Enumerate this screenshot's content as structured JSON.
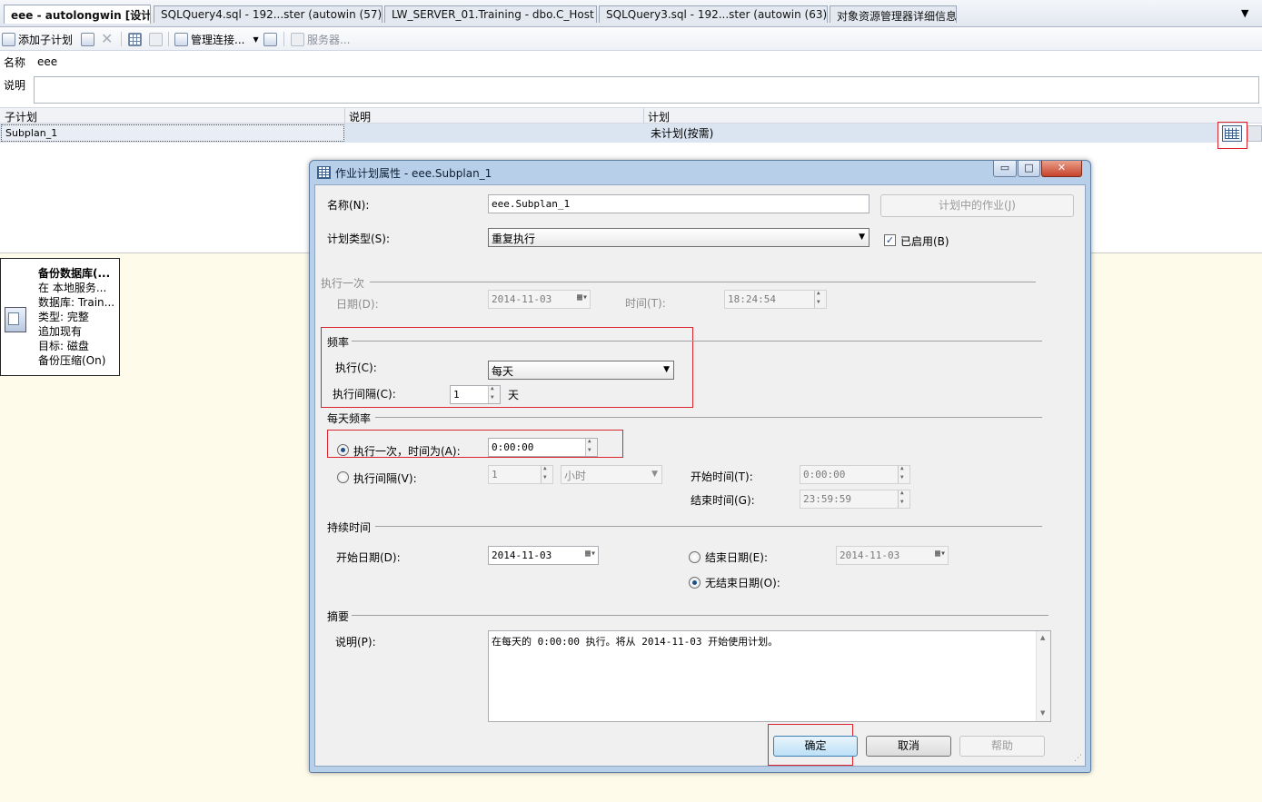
{
  "tabs": [
    {
      "label": "eee - autolongwin [设计]",
      "active": true
    },
    {
      "label": "SQLQuery4.sql - 192...ster (autowin (57))",
      "active": false
    },
    {
      "label": "LW_SERVER_01.Training - dbo.C_Host",
      "active": false
    },
    {
      "label": "SQLQuery3.sql - 192...ster (autowin (63))",
      "active": false
    },
    {
      "label": "对象资源管理器详细信息",
      "active": false
    }
  ],
  "tab_overflow_icon": "▼",
  "toolbar": {
    "add_subplan": "添加子计划",
    "manage_connections": "管理连接...",
    "servers": "服务器..."
  },
  "plan": {
    "name_label": "名称",
    "name_value": "eee",
    "desc_label": "说明",
    "desc_value": ""
  },
  "subplan_grid": {
    "headers": [
      "子计划",
      "说明",
      "计划"
    ],
    "rows": [
      {
        "name": "Subplan_1",
        "description": "",
        "schedule": "未计划(按需)"
      }
    ]
  },
  "task": {
    "title": "备份数据库(...",
    "lines": [
      "在 本地服务...",
      "数据库: Train...",
      "类型: 完整",
      "追加现有",
      "目标: 磁盘",
      "备份压缩(On)"
    ]
  },
  "dialog": {
    "title": "作业计划属性 - eee.Subplan_1",
    "caption_buttons": {
      "minimize": "▭",
      "maximize": "□",
      "close": "✕"
    },
    "name_label": "名称(N):",
    "name_value": "eee.Subplan_1",
    "jobs_in_schedule": "计划中的作业(J)",
    "schedule_type_label": "计划类型(S):",
    "schedule_type_value": "重复执行",
    "enabled_label": "已启用(B)",
    "enabled": true,
    "one_time": {
      "group": "执行一次",
      "date_label": "日期(D):",
      "date_value": "2014-11-03",
      "time_label": "时间(T):",
      "time_value": "18:24:54"
    },
    "frequency": {
      "group": "频率",
      "occurs_label": "执行(C):",
      "occurs_value": "每天",
      "recurs_label": "执行间隔(C):",
      "recurs_value": "1",
      "recurs_unit": "天"
    },
    "daily_frequency": {
      "group": "每天频率",
      "once_label": "执行一次，时间为(A):",
      "once_value": "0:00:00",
      "once_selected": true,
      "every_label": "执行间隔(V):",
      "every_value": "1",
      "every_unit": "小时",
      "start_label": "开始时间(T):",
      "start_value": "0:00:00",
      "end_label": "结束时间(G):",
      "end_value": "23:59:59"
    },
    "duration": {
      "group": "持续时间",
      "start_date_label": "开始日期(D):",
      "start_date_value": "2014-11-03",
      "end_date_label": "结束日期(E):",
      "end_date_value": "2014-11-03",
      "no_end_label": "无结束日期(O):",
      "no_end_selected": true
    },
    "summary": {
      "group": "摘要",
      "desc_label": "说明(P):",
      "desc_value": "在每天的 0:00:00 执行。将从 2014-11-03 开始使用计划。"
    },
    "buttons": {
      "ok": "确定",
      "cancel": "取消",
      "help": "帮助"
    }
  },
  "icons": {
    "add_subplan": "add-subplan-icon",
    "calendar": "calendar-icon",
    "dropdown": "▼",
    "check": "✓"
  },
  "colors": {
    "highlight_red": "#d9232d",
    "designer_bg": "#fefbea",
    "dialog_frame": "#b8cfe9"
  }
}
